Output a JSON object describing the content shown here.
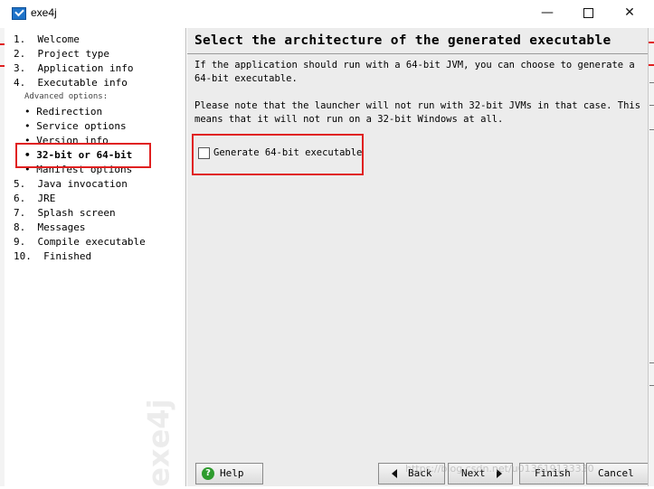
{
  "window": {
    "title": "exe4j"
  },
  "sidebar": {
    "steps": [
      "1.  Welcome",
      "2.  Project type",
      "3.  Application info",
      "4.  Executable info",
      "5.  Java invocation",
      "6.  JRE",
      "7.  Splash screen",
      "8.  Messages",
      "9.  Compile executable",
      "10.  Finished"
    ],
    "advanced_label": "Advanced options:",
    "sub_items": [
      "• Redirection",
      "• Service options",
      "• Version info",
      "• 32-bit or 64-bit",
      "• Manifest options"
    ],
    "watermark": "exe4j"
  },
  "content": {
    "title": "Select the architecture of the generated executable",
    "para1": "If the application should run with a 64-bit JVM, you can choose to generate a\n64-bit executable.",
    "para2": "Please note that the launcher will not run with 32-bit JVMs in that case. This\nmeans that it will not run on a 32-bit Windows at all.",
    "checkbox_label": "Generate 64-bit executable",
    "checkbox_checked": false
  },
  "buttons": {
    "help": "Help",
    "back": "Back",
    "next": "Next",
    "finish": "Finish",
    "cancel": "Cancel"
  },
  "overlay": {
    "watermark_url": "https://blog.csdn.net/u013619133330"
  },
  "colors": {
    "annotation_red": "#e02020",
    "help_green": "#2e9b2e"
  }
}
